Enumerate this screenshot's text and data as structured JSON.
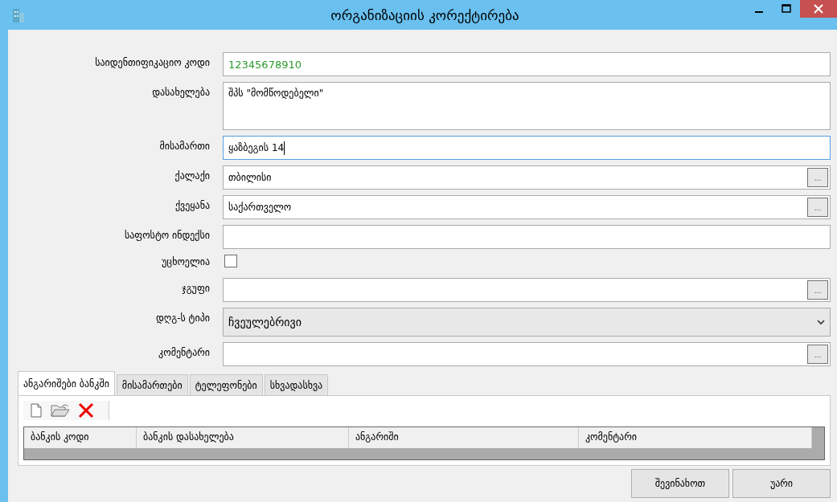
{
  "window": {
    "title": "ორგანიზაციის კორექტირება"
  },
  "fields": [
    {
      "kind": "text",
      "label": "საიდენთიფიკაციო კოდი",
      "value": "12345678910",
      "focused": false
    },
    {
      "kind": "multiline",
      "label": "დასახელება",
      "value": "შპს \"მომწოდებელი\"",
      "focused": false
    },
    {
      "kind": "text",
      "label": "მისამართი",
      "value": "ყაზბეგის 14",
      "focused": true
    },
    {
      "kind": "lookup",
      "label": "ქალაქი",
      "value": "თბილისი",
      "button": "..."
    },
    {
      "kind": "lookup",
      "label": "ქვეყანა",
      "value": "საქართველო",
      "button": "..."
    },
    {
      "kind": "text",
      "label": "საფოსტო ინდექსი",
      "focused": false
    },
    {
      "kind": "checkbox",
      "label": "უცხოელია",
      "checked": false
    },
    {
      "kind": "lookup",
      "label": "ჯგუფი",
      "button": "..."
    },
    {
      "kind": "dropdown",
      "label": "დღგ-ს ტიპი",
      "value": "ჩვეულებრივი"
    },
    {
      "kind": "lookup",
      "label": "კომენტარი",
      "button": "..."
    }
  ],
  "tabs": [
    {
      "label": "ანგარიშები ბანკში",
      "selected": true
    },
    {
      "label": "მისამართები",
      "selected": false
    },
    {
      "label": "ტელეფონები",
      "selected": false
    },
    {
      "label": "სხვადასხვა",
      "selected": false
    }
  ],
  "table": {
    "columns": [
      "ბანკის კოდი",
      "ბანკის დასახელება",
      "ანგარიში",
      "კომენტარი"
    ]
  },
  "buttons": [
    "შევინახოთ",
    "უარი"
  ]
}
